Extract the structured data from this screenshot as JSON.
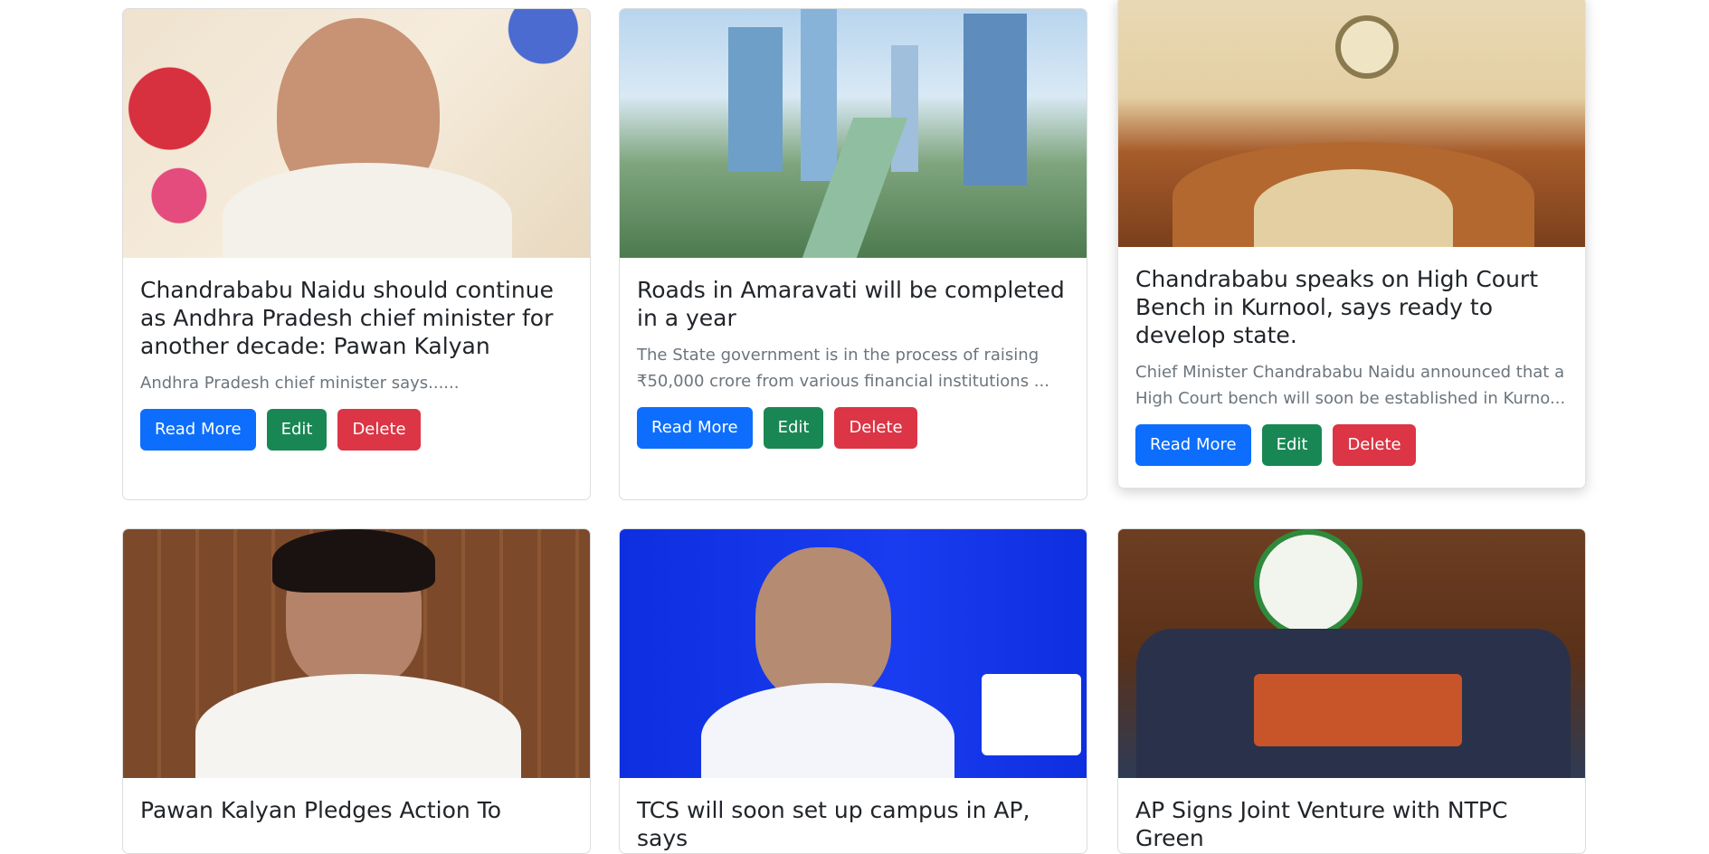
{
  "cards": [
    {
      "title": "Chandrababu Naidu should continue as Andhra Pradesh chief minister for another decade: Pawan Kalyan",
      "excerpt": "Andhra Pradesh chief minister says......",
      "read_label": "Read More",
      "edit_label": "Edit",
      "delete_label": "Delete"
    },
    {
      "title": "Roads in Amaravati will be completed in a year",
      "excerpt": "The State government is in the process of raising ₹50,000 crore from various financial institutions ...",
      "read_label": "Read More",
      "edit_label": "Edit",
      "delete_label": "Delete"
    },
    {
      "title": "Chandrababu speaks on High Court Bench in Kurnool, says ready to develop state.",
      "excerpt": "Chief Minister Chandrababu Naidu announced that a High Court bench will soon be established in Kurno...",
      "read_label": "Read More",
      "edit_label": "Edit",
      "delete_label": "Delete"
    },
    {
      "title": "Pawan Kalyan Pledges Action To"
    },
    {
      "title": "TCS will soon set up campus in AP, says"
    },
    {
      "title": "AP Signs Joint Venture with NTPC Green"
    }
  ],
  "colors": {
    "primary": "#0d6efd",
    "success": "#198754",
    "danger": "#dc3545",
    "muted_text": "#6c757d"
  }
}
